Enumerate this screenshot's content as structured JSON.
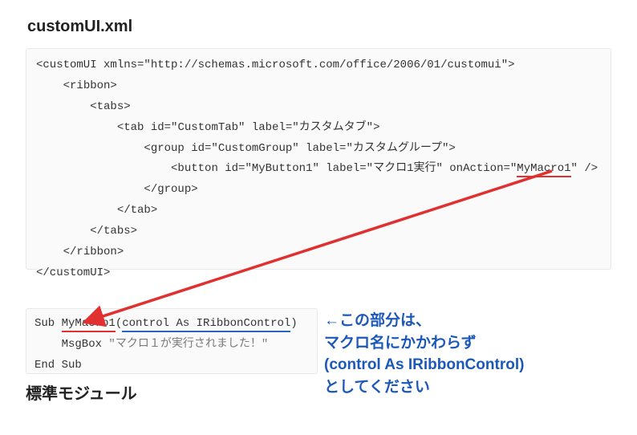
{
  "titles": {
    "top": "customUI.xml",
    "bottom": "標準モジュール"
  },
  "xml": {
    "l1a": "<customUI xmlns=\"http://schemas.microsoft.com/office/2006/01/customui\">",
    "l2": "<ribbon>",
    "l3": "<tabs>",
    "l4": "<tab id=\"CustomTab\" label=\"カスタムタブ\">",
    "l5": "<group id=\"CustomGroup\" label=\"カスタムグループ\">",
    "l6a": "<button id=\"MyButton1\" label=\"マクロ1実行\" onAction=\"",
    "l6b": "MyMacro1",
    "l6c": "\" />",
    "l7": "</group>",
    "l8": "</tab>",
    "l9": "</tabs>",
    "l10": "</ribbon>",
    "l11": "</customUI>"
  },
  "vba": {
    "l1a": "Sub ",
    "l1b": "MyMacro1",
    "l1c": "(",
    "l1d": "control As IRibbonControl",
    "l1e": ")",
    "l2a": "    MsgBox ",
    "l2b": "\"マクロ１が実行されました！\"",
    "l3": "End Sub"
  },
  "annotation": {
    "l1": "←この部分は、",
    "l2": "マクロ名にかかわらず",
    "l3": "(control As IRibbonControl)",
    "l4": "としてください"
  }
}
